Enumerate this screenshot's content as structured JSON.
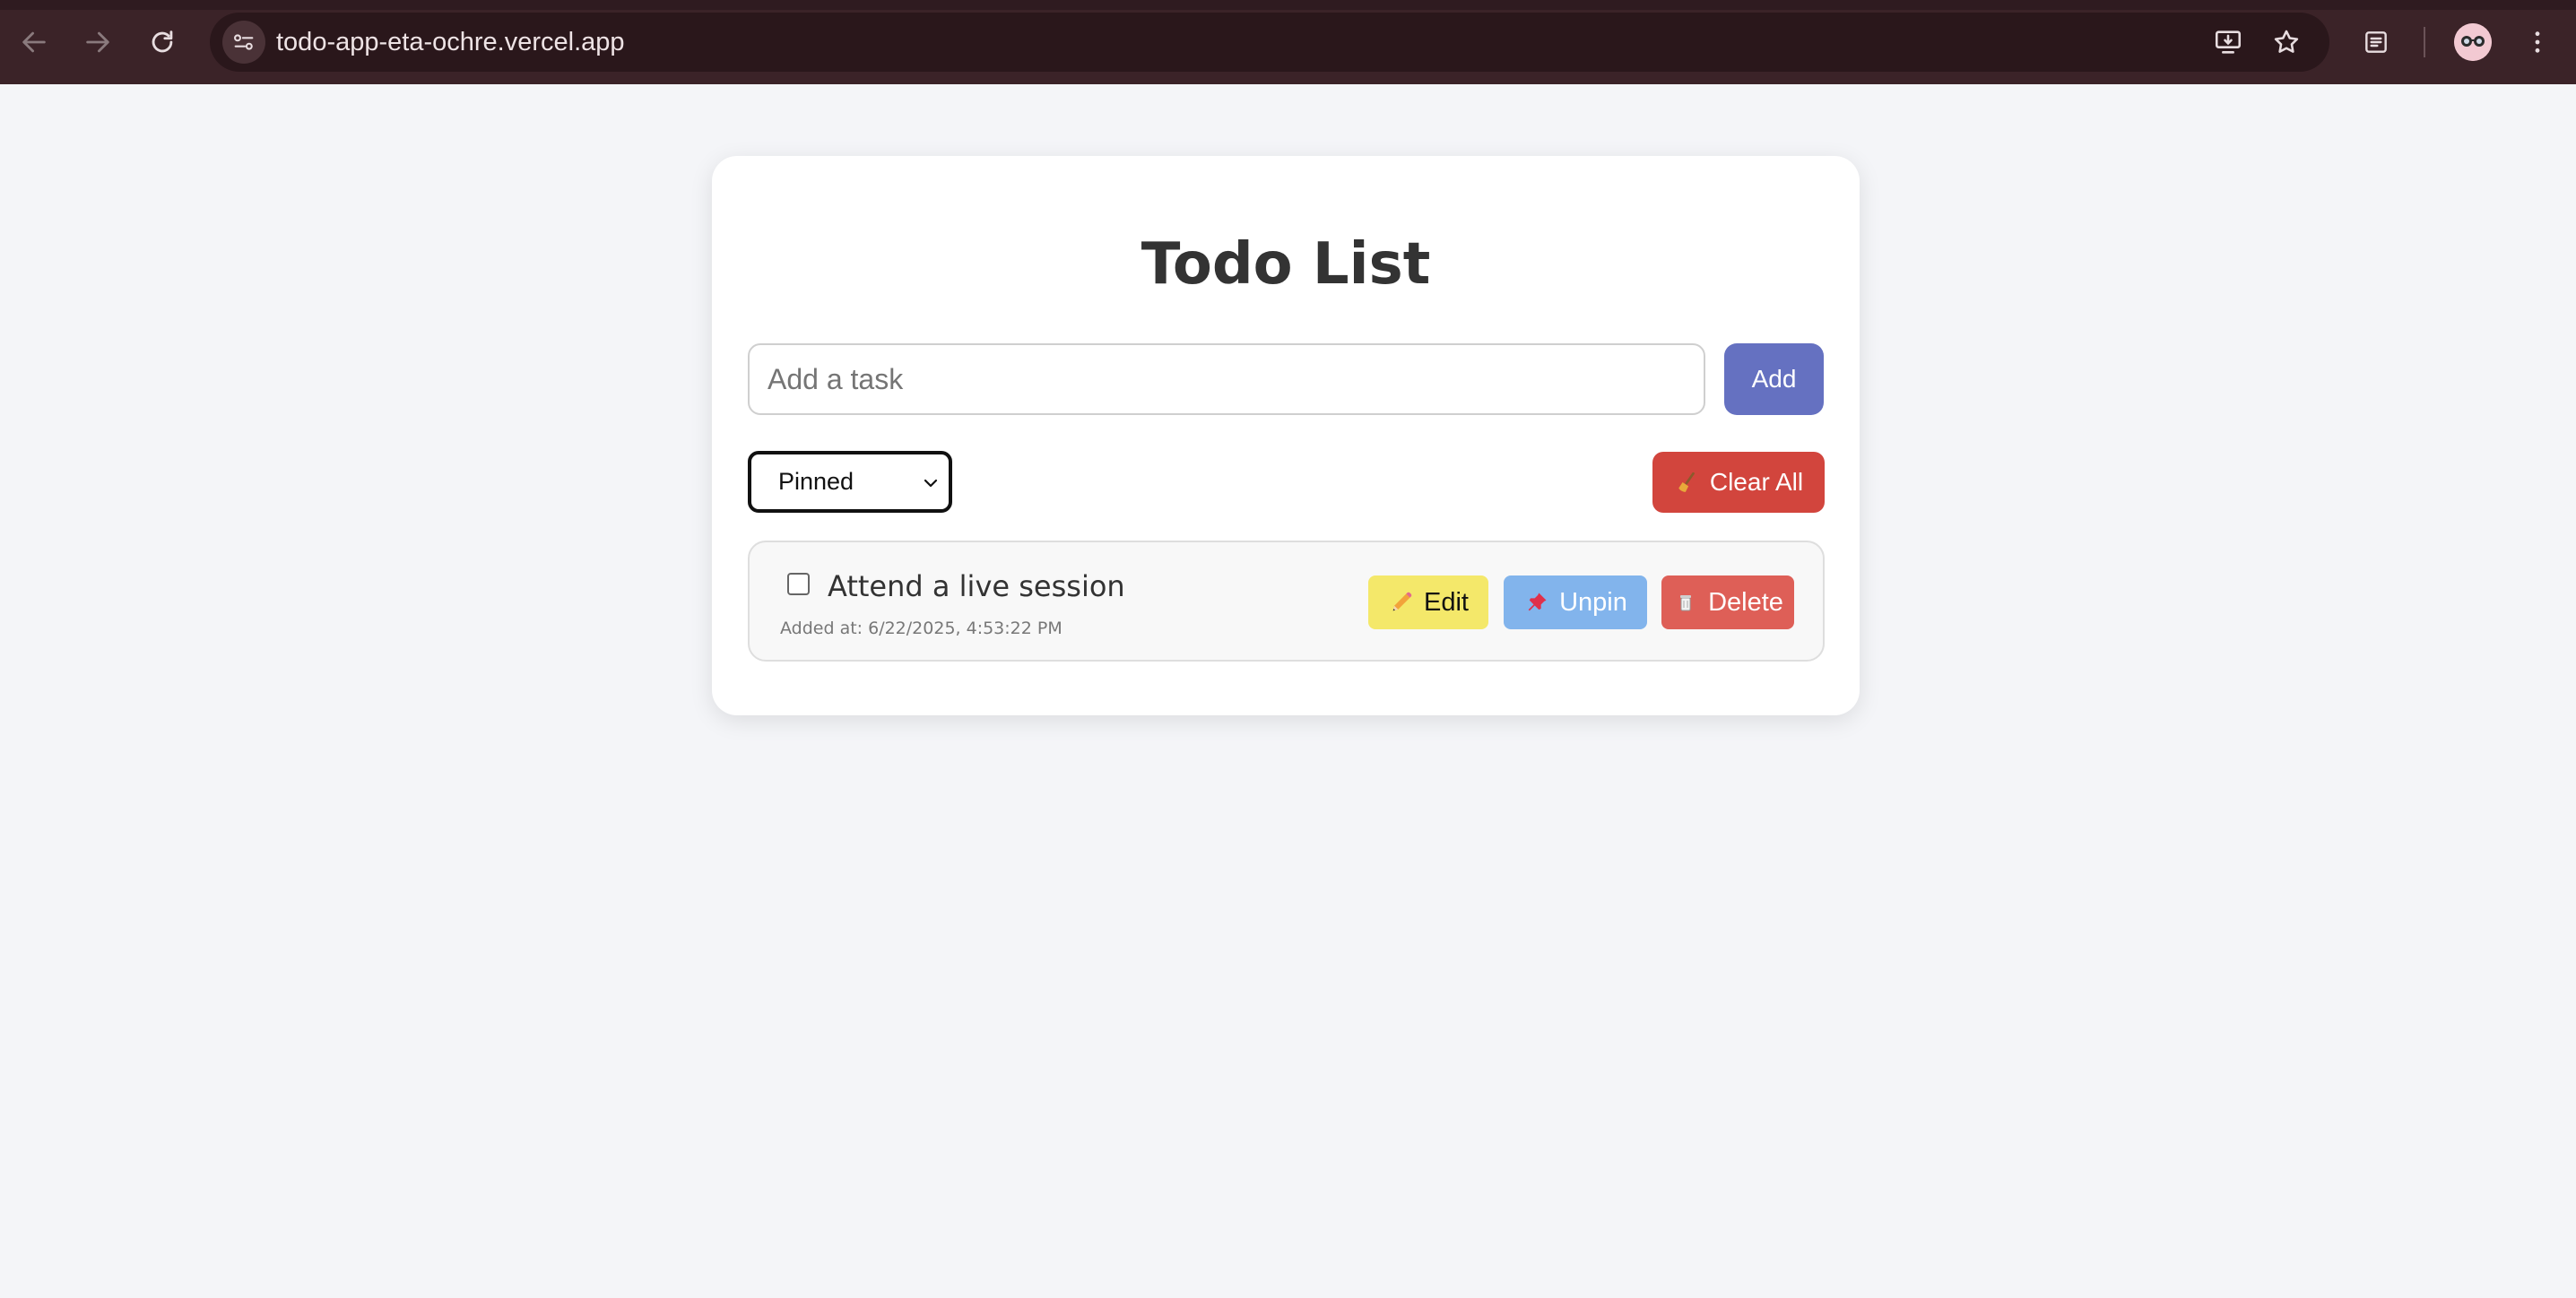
{
  "browser": {
    "url": "todo-app-eta-ochre.vercel.app"
  },
  "app": {
    "title": "Todo List",
    "input_placeholder": "Add a task",
    "input_value": "",
    "add_label": "Add",
    "filter_selected": "Pinned",
    "clear_all_label": "Clear All",
    "todos": [
      {
        "text": "Attend a live session",
        "added": "Added at: 6/22/2025, 4:53:22 PM",
        "completed": false,
        "edit_label": "Edit",
        "pin_label": "Unpin",
        "delete_label": "Delete"
      }
    ]
  },
  "colors": {
    "add_button": "#6571c1",
    "clear_button": "#d2453d",
    "edit_button": "#f4e86a",
    "unpin_button": "#82b4ec",
    "delete_button": "#de5f57"
  }
}
